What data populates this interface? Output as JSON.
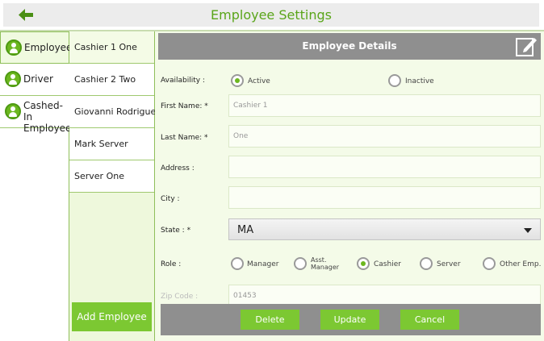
{
  "header": {
    "title": "Employee Settings"
  },
  "categories": [
    {
      "label": "Employee",
      "selected": true
    },
    {
      "label": "Driver",
      "selected": false
    },
    {
      "label": "Cashed-In Employee",
      "label_line1": "Cashed-In",
      "label_line2": "Employee",
      "selected": false
    }
  ],
  "employees": [
    {
      "name": "Cashier 1 One",
      "selected": true
    },
    {
      "name": "Cashier 2 Two",
      "selected": false
    },
    {
      "name": "Giovanni Rodriguez",
      "selected": false
    },
    {
      "name": "Mark Server",
      "selected": false
    },
    {
      "name": "Server One",
      "selected": false
    }
  ],
  "add_button": "Add Employee",
  "details": {
    "title": "Employee Details",
    "availability": {
      "label": "Availability :",
      "options": [
        {
          "label": "Active",
          "selected": true
        },
        {
          "label": "Inactive",
          "selected": false
        }
      ]
    },
    "first_name": {
      "label": "First Name: *",
      "value": "Cashier 1"
    },
    "last_name": {
      "label": "Last Name: *",
      "value": "One"
    },
    "address": {
      "label": "Address :",
      "value": ""
    },
    "city": {
      "label": "City :",
      "value": ""
    },
    "state": {
      "label": "State : *",
      "value": "MA"
    },
    "role": {
      "label": "Role :",
      "options": [
        {
          "label": "Manager",
          "selected": false
        },
        {
          "label": "Asst. Manager",
          "label_line1": "Asst.",
          "label_line2": "Manager",
          "selected": false
        },
        {
          "label": "Cashier",
          "selected": true
        },
        {
          "label": "Server",
          "selected": false
        },
        {
          "label": "Other Emp.",
          "selected": false
        }
      ]
    },
    "zip_code": {
      "label": "Zip Code :",
      "value": "01453"
    }
  },
  "actions": {
    "delete": "Delete",
    "update": "Update",
    "cancel": "Cancel"
  },
  "colors": {
    "accent": "#7cc832",
    "title": "#5aa51a",
    "bar": "#8f8f8f"
  }
}
